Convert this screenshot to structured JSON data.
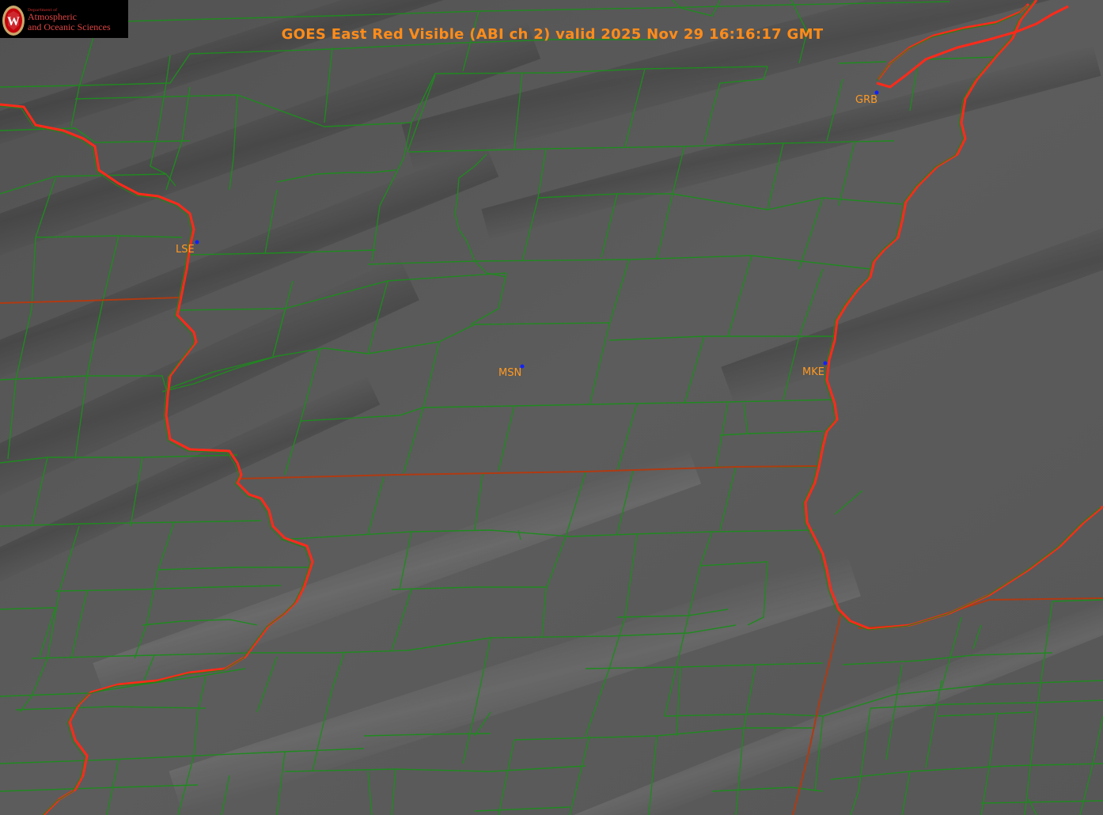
{
  "title": "GOES East Red Visible (ABI ch 2) valid 2025 Nov 29 16:16:17 GMT",
  "logo": {
    "department_line": "Department of",
    "line1": "Atmospheric",
    "line2": "and Oceanic Sciences",
    "seal_letter": "W"
  },
  "stations": [
    {
      "id": "LSE",
      "label": "LSE"
    },
    {
      "id": "MSN",
      "label": "MSN"
    },
    {
      "id": "MKE",
      "label": "MKE"
    },
    {
      "id": "GRB",
      "label": "GRB"
    }
  ],
  "colors": {
    "county_lines": "#1f8a1f",
    "state_lines": "#b03a12",
    "water_outline": "#ff2a1a",
    "title_text": "#ff8c1a",
    "station_label": "#ff9922",
    "station_dot": "#1020ff",
    "cloud_gray": "#5a5a5a"
  }
}
